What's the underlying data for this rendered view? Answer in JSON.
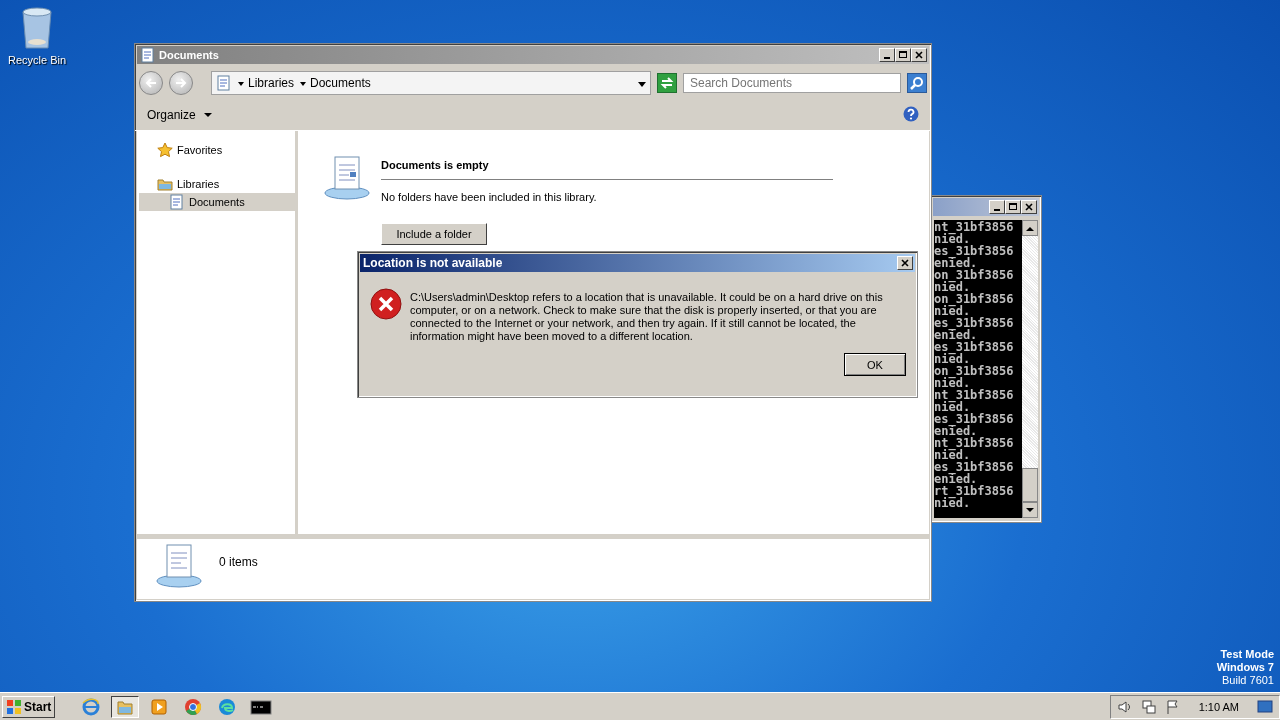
{
  "desktop": {
    "icons": [
      {
        "label": "Recycle Bin"
      }
    ],
    "os_notice": [
      "Test Mode",
      "Windows 7",
      "Build 7601"
    ]
  },
  "console_window": {
    "lines": [
      "nt_31bf3856",
      "nied.",
      "es_31bf3856",
      "enied.",
      "on_31bf3856",
      "nied.",
      "on_31bf3856",
      "nied.",
      "es_31bf3856",
      "enied.",
      "es_31bf3856",
      "nied.",
      "on_31bf3856",
      "nied.",
      "nt_31bf3856",
      "nied.",
      "es_31bf3856",
      "enied.",
      "nt_31bf3856",
      "nied.",
      "es_31bf3856",
      "enied.",
      "rt_31bf3856",
      "nied."
    ]
  },
  "explorer": {
    "title": "Documents",
    "breadcrumb": [
      "Libraries",
      "Documents"
    ],
    "search": {
      "placeholder": "Search Documents"
    },
    "organize": "Organize",
    "nav": [
      {
        "label": "Favorites",
        "kind": "favorites",
        "selected": false
      },
      {
        "label": "Libraries",
        "kind": "libraries",
        "selected": false,
        "children": [
          {
            "label": "Documents",
            "kind": "document",
            "selected": true
          }
        ]
      }
    ],
    "content": {
      "heading": "Documents is empty",
      "message": "No folders have been included in this library.",
      "button": "Include a folder"
    },
    "details": {
      "count": "0 items"
    }
  },
  "dialog": {
    "title": "Location is not available",
    "message": "C:\\Users\\admin\\Desktop refers to a location that is unavailable. It could be on a hard drive on this computer, or on a network. Check to make sure that the disk is properly inserted, or that you are connected to the Internet or your network, and then try again. If it still cannot be located, the information might have been moved to a different location.",
    "button": "OK"
  },
  "taskbar": {
    "start": "Start",
    "apps": [
      {
        "kind": "browser",
        "selected": false
      },
      {
        "kind": "folder",
        "selected": true
      },
      {
        "kind": "media",
        "selected": false
      },
      {
        "kind": "chrome",
        "selected": false
      },
      {
        "kind": "edge",
        "selected": false
      },
      {
        "kind": "console",
        "selected": false
      }
    ],
    "clock": "1:10 AM"
  }
}
